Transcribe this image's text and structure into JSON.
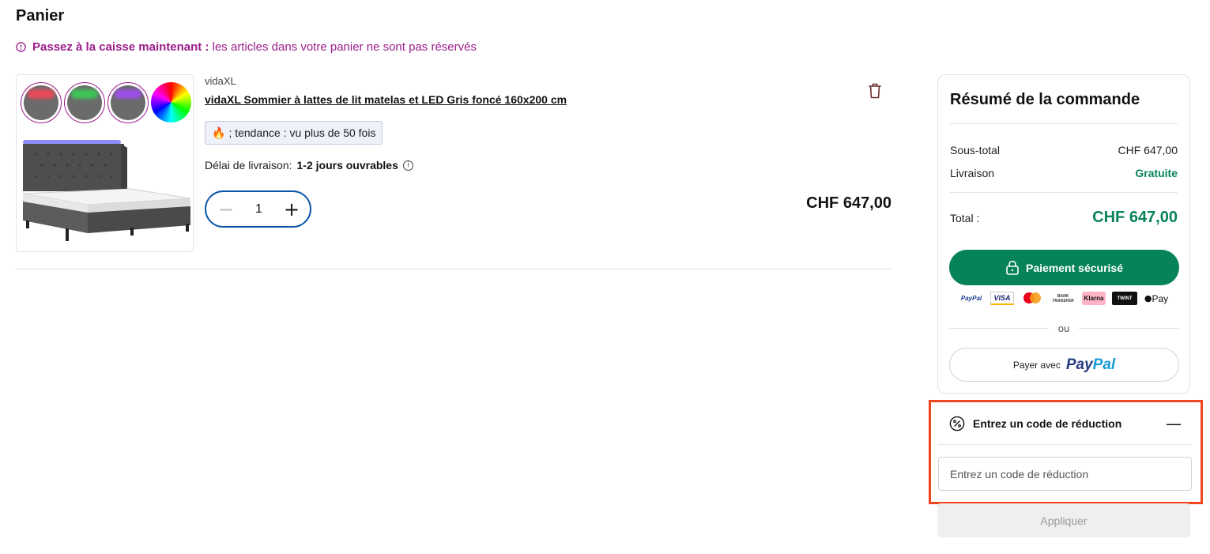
{
  "cart": {
    "title": "Panier",
    "notice_bold": "Passez à la caisse maintenant :",
    "notice_rest": "les articles dans votre panier ne sont pas réservés"
  },
  "product": {
    "brand": "vidaXL",
    "name": "vidaXL Sommier à lattes de lit matelas et LED Gris foncé 160x200 cm",
    "trend_badge": "; tendance : vu plus de 50 fois",
    "delivery_label": "Délai de livraison:",
    "delivery_value": "1-2 jours ouvrables",
    "quantity": "1",
    "price": "CHF 647,00",
    "swatch_colors": [
      "#e84a5a",
      "#3ec457",
      "#9b4fe6",
      "rainbow"
    ]
  },
  "summary": {
    "title": "Résumé de la commande",
    "subtotal_label": "Sous-total",
    "subtotal_value": "CHF 647,00",
    "shipping_label": "Livraison",
    "shipping_value": "Gratuite",
    "total_label": "Total :",
    "total_value": "CHF 647,00",
    "pay_button": "Paiement sécurisé",
    "payment_logos": [
      "PayPal",
      "VISA",
      "Mastercard",
      "BANK TRANSFER",
      "Klarna",
      "TWINT",
      "Pay"
    ],
    "or_text": "ou",
    "paypal_prefix": "Payer avec",
    "paypal_word_1": "Pay",
    "paypal_word_2": "Pal"
  },
  "discount": {
    "title": "Entrez un code de réduction",
    "placeholder": "Entrez un code de réduction",
    "apply_button": "Appliquer"
  },
  "colors": {
    "accent_green": "#07835b",
    "notice_purple": "#9b1d8a",
    "qty_border_blue": "#0a56a8",
    "highlight_red": "#f0461f"
  }
}
